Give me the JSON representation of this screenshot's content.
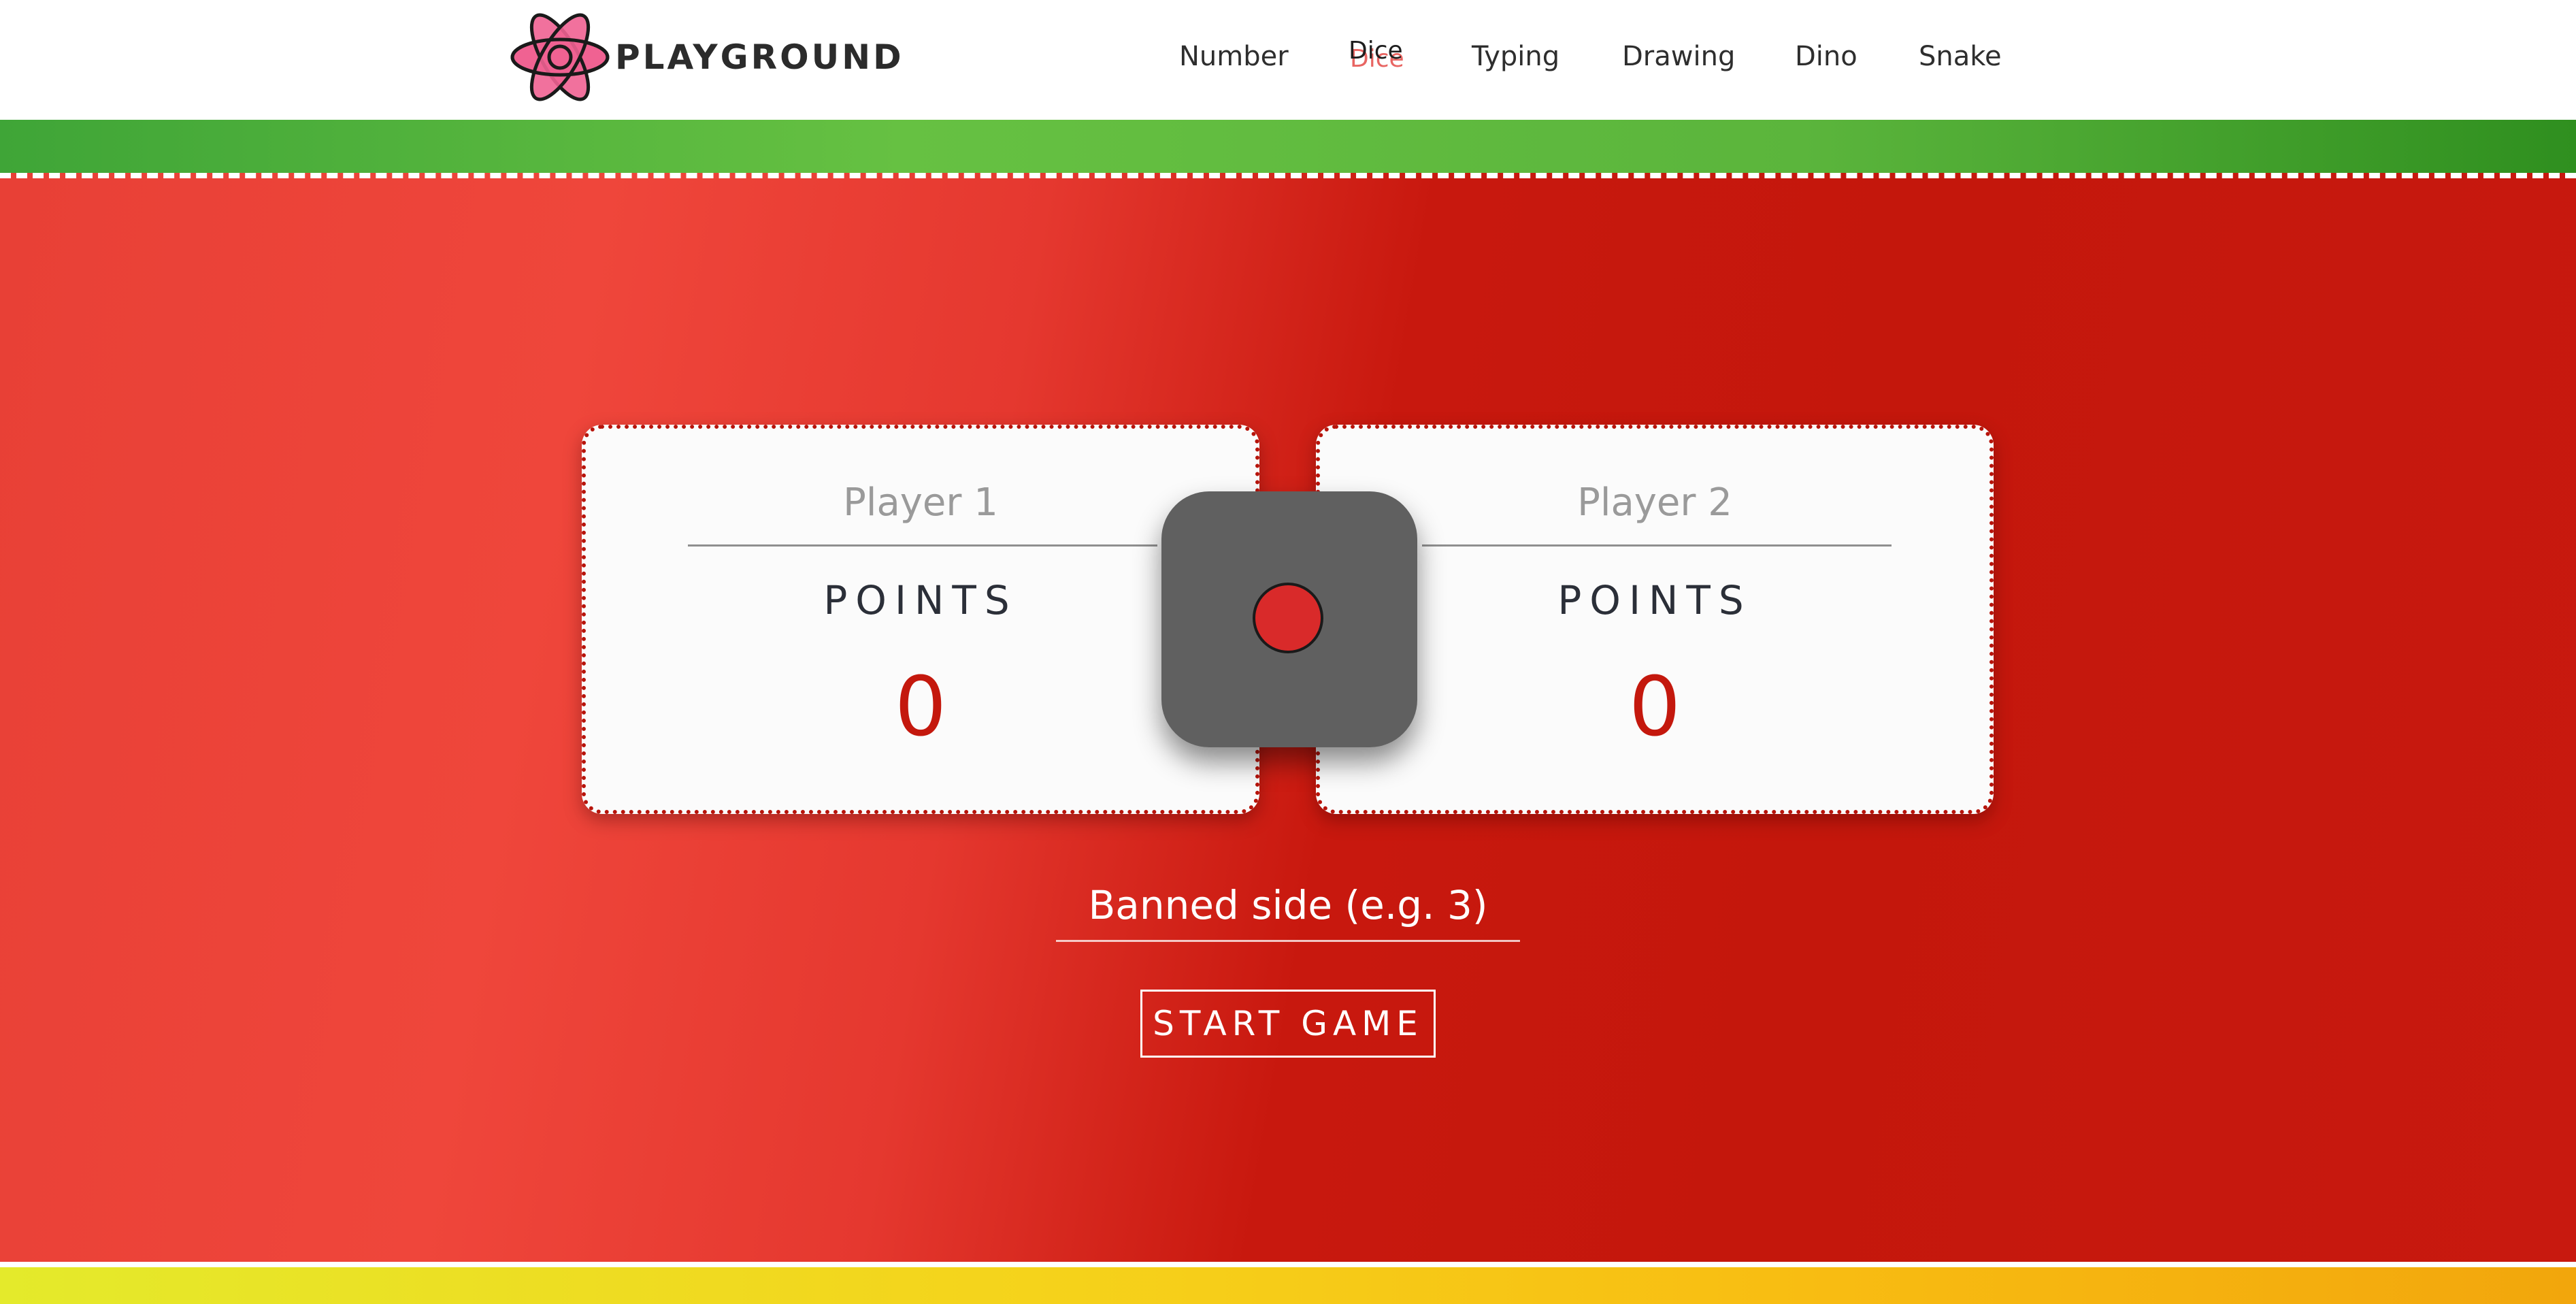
{
  "brand": {
    "name": "PLAYGROUND",
    "logo_icon": "atom-icon"
  },
  "nav": {
    "items": [
      {
        "label": "Number"
      },
      {
        "label": "Dice",
        "active": true
      },
      {
        "label": "Typing"
      },
      {
        "label": "Drawing"
      },
      {
        "label": "Dino"
      },
      {
        "label": "Snake"
      }
    ]
  },
  "players": [
    {
      "name": "Player 1",
      "points_label": "POINTS",
      "points": "0"
    },
    {
      "name": "Player 2",
      "points_label": "POINTS",
      "points": "0"
    }
  ],
  "die": {
    "face": 1,
    "pip_color": "#d92a2a",
    "body_color": "#606060"
  },
  "banned_side": {
    "value": "",
    "placeholder": "Banned side (e.g. 3)"
  },
  "start_button": {
    "label": "START GAME"
  },
  "colors": {
    "red_primary": "#c4180d",
    "red_light": "#ef463b",
    "green_band": "#5bb53c",
    "yellow_band": "#f8bd12"
  }
}
